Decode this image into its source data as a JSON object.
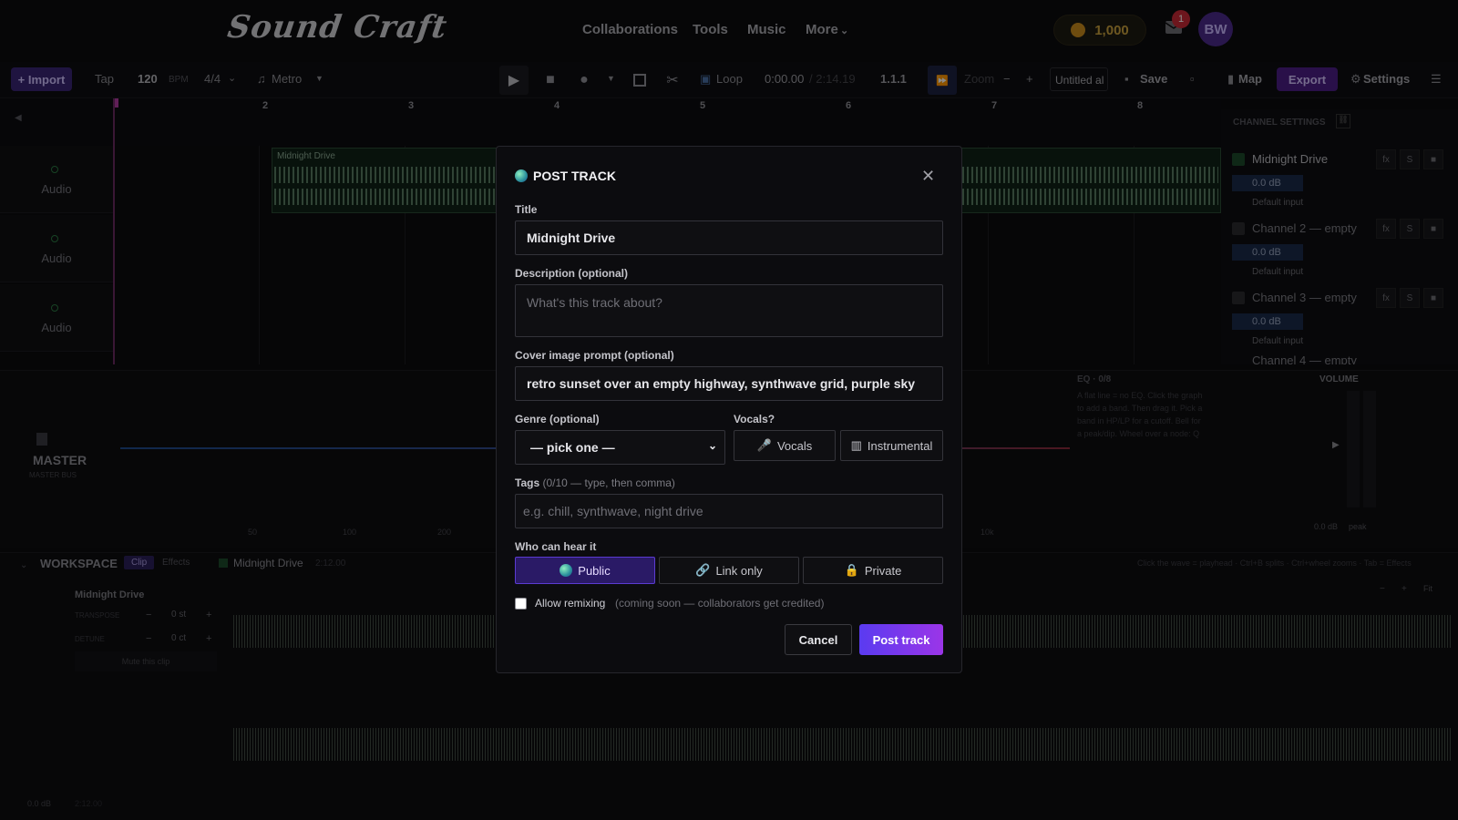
{
  "nav": {
    "logo": "Sound Craft",
    "links": [
      "Collaborations",
      "Tools",
      "Music",
      "More"
    ],
    "coins": "1,000",
    "notif_count": "1",
    "avatar": "BW"
  },
  "toolbar": {
    "import": "+ Import",
    "tap": "Tap",
    "bpm": "120",
    "bpm_unit": "BPM",
    "meter": "4/4",
    "metro": "Metro",
    "loop": "Loop",
    "time": "0:00.00",
    "duration": "/ 2:14.19",
    "position": "1.1.1",
    "zoom": "Zoom",
    "project_title": "Untitled al",
    "save": "Save",
    "map": "Map",
    "export": "Export",
    "settings": "Settings"
  },
  "ruler": {
    "bars": [
      "2",
      "3",
      "4",
      "5",
      "6",
      "7",
      "8"
    ]
  },
  "tracks": [
    {
      "label": "Audio",
      "clip": "Midnight Drive"
    },
    {
      "label": "Audio"
    },
    {
      "label": "Audio"
    }
  ],
  "channel_settings": {
    "header": "CHANNEL SETTINGS",
    "channels": [
      {
        "name": "Midnight Drive",
        "db": "0.0 dB",
        "input": "Default input"
      },
      {
        "name": "Channel 2 — empty",
        "db": "0.0 dB",
        "input": "Default input"
      },
      {
        "name": "Channel 3 — empty",
        "db": "0.0 dB",
        "input": "Default input"
      },
      {
        "name": "Channel 4 — empty"
      }
    ],
    "fx": "fx",
    "solo": "S"
  },
  "master": {
    "title": "MASTER",
    "sub": "MASTER BUS",
    "eq_label": "EQ · 0/8",
    "eq_hint": "A flat line = no EQ. Click the graph to add a band. Then drag it. Pick a band in HP/LP for a cutoff. Bell for a peak/dip. Wheel over a node: Q",
    "volume": "VOLUME",
    "vol_db": "0.0 dB",
    "peak": "peak",
    "freq_ticks": [
      "50",
      "100",
      "200",
      "10k"
    ]
  },
  "workspace": {
    "title": "WORKSPACE",
    "tab_clip": "Clip",
    "tab_effects": "Effects",
    "clip_name": "Midnight Drive",
    "clip_len": "2:12.00",
    "hint": "Click the wave = playhead · Ctrl+B splits · Ctrl+wheel zooms · Tab = Effects",
    "transpose_label": "TRANSPOSE",
    "transpose": "0 st",
    "detune_label": "DETUNE",
    "detune": "0 ct",
    "mute": "Mute this clip",
    "fit": "Fit",
    "db_foot": "0.0 dB",
    "time_foot": "2:12.00"
  },
  "modal": {
    "title": "POST TRACK",
    "title_label": "Title",
    "title_value": "Midnight Drive",
    "desc_label": "Description",
    "desc_opt": "(optional)",
    "desc_placeholder": "What's this track about?",
    "cover_label": "Cover image prompt",
    "cover_opt": "(optional)",
    "cover_value": "retro sunset over an empty highway, synthwave grid, purple sky",
    "genre_label": "Genre",
    "genre_opt": "(optional)",
    "genre_value": "— pick one —",
    "vocals_label": "Vocals?",
    "vocals_btn": "Vocals",
    "instrumental_btn": "Instrumental",
    "tags_label": "Tags",
    "tags_hint": "(0/10 — type, then comma)",
    "tags_placeholder": "e.g. chill, synthwave, night drive",
    "who_label": "Who can hear it",
    "vis_public": "Public",
    "vis_link": "Link only",
    "vis_private": "Private",
    "remix_label": "Allow remixing",
    "remix_hint": "(coming soon — collaborators get credited)",
    "cancel": "Cancel",
    "post": "Post track"
  }
}
